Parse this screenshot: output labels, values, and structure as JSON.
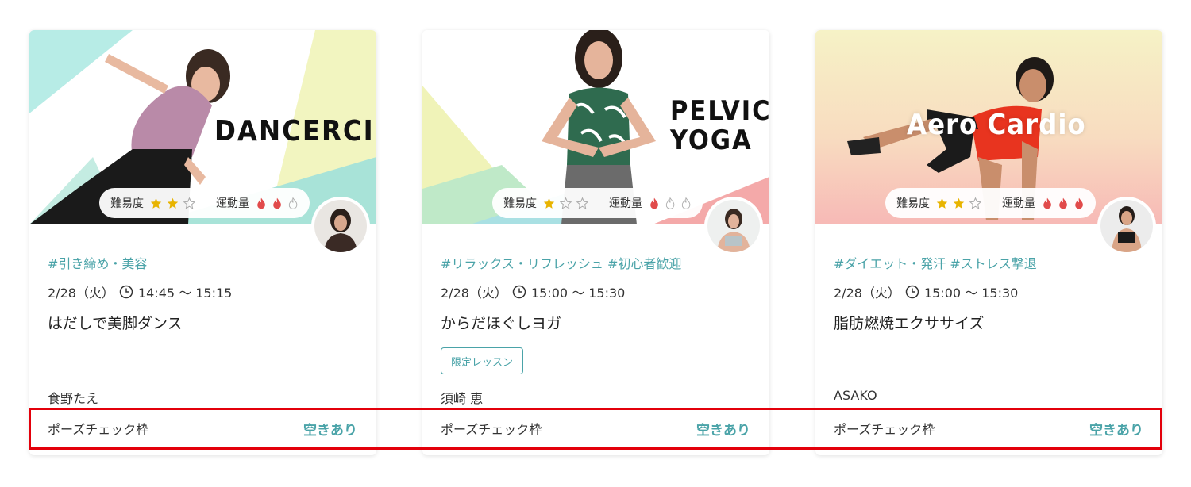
{
  "labels": {
    "difficulty": "難易度",
    "intensity": "運動量"
  },
  "colors": {
    "accent": "#4aa3a8",
    "highlight": "#e3000b",
    "star": "#e8b400",
    "flame": "#e14b4b"
  },
  "cards": [
    {
      "hero_text": "DANCERCISE",
      "difficulty": 2,
      "intensity": 2,
      "tags": "#引き締め・美容",
      "date": "2/28（火）",
      "time": "14:45 〜 15:15",
      "title": "はだしで美脚ダンス",
      "instructor": "食野たえ",
      "pose_check": "ポーズチェック枠",
      "availability": "空きあり"
    },
    {
      "hero_text_line1": "PELVIC",
      "hero_text_line2": "YOGA",
      "difficulty": 1,
      "intensity": 1,
      "tags": "#リラックス・リフレッシュ #初心者歓迎",
      "date": "2/28（火）",
      "time": "15:00 〜 15:30",
      "title": "からだほぐしヨガ",
      "limited_label": "限定レッスン",
      "instructor": "須崎 恵",
      "pose_check": "ポーズチェック枠",
      "availability": "空きあり"
    },
    {
      "hero_text": "Aero Cardio",
      "difficulty": 2,
      "intensity": 3,
      "tags": "#ダイエット・発汗 #ストレス撃退",
      "date": "2/28（火）",
      "time": "15:00 〜 15:30",
      "title": "脂肪燃焼エクササイズ",
      "instructor": "ASAKO",
      "pose_check": "ポーズチェック枠",
      "availability": "空きあり"
    }
  ]
}
